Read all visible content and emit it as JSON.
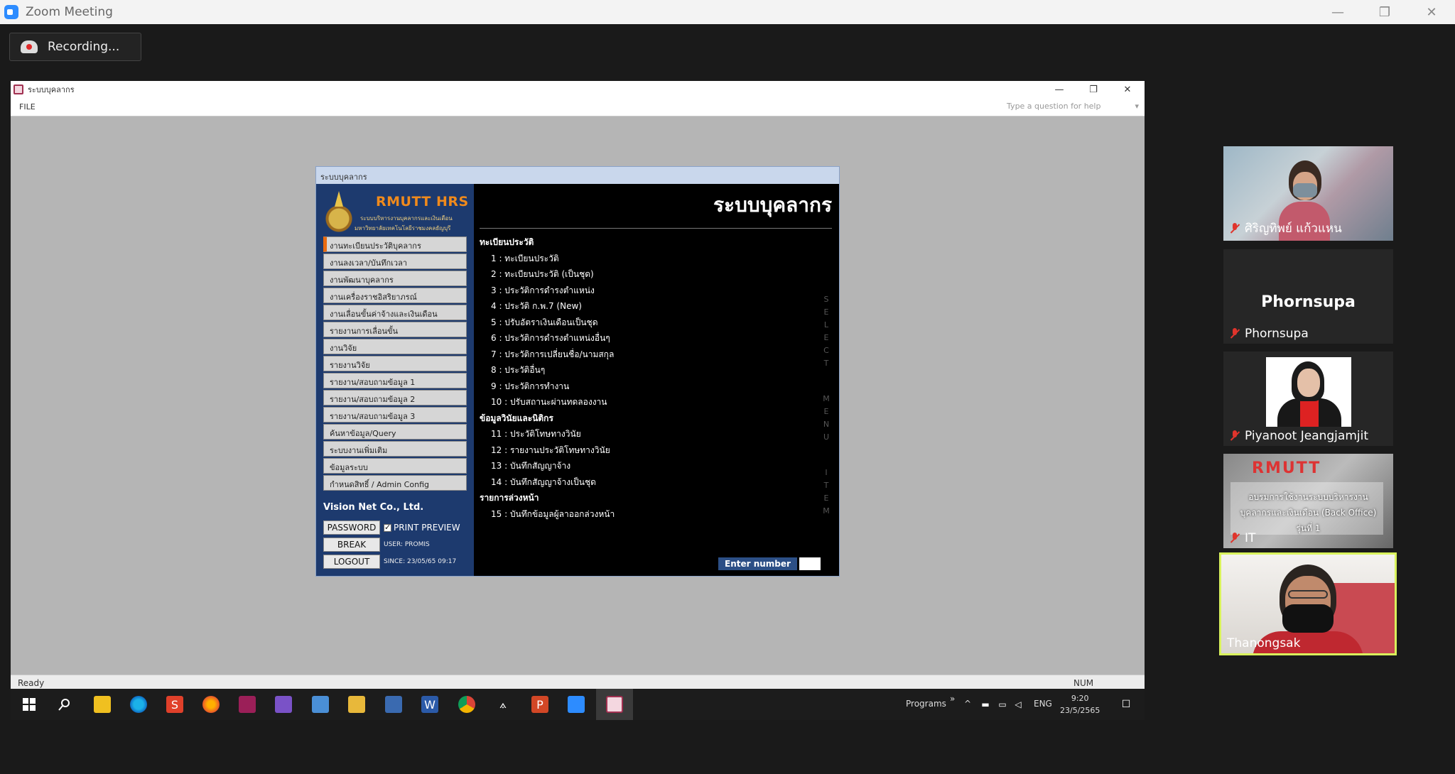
{
  "zoom": {
    "window_title": "Zoom Meeting",
    "recording_label": "Recording...",
    "controls": [
      "—",
      "❐",
      "✕"
    ]
  },
  "app": {
    "window_title": "ระบบบุคลากร",
    "controls": [
      "—",
      "❐",
      "✕"
    ],
    "menu_file": "FILE",
    "help_placeholder": "Type a question for help",
    "help_arrow": "▾",
    "status_ready": "Ready",
    "status_num": "NUM"
  },
  "dialog": {
    "title": "ระบบบุคลากร",
    "logo_name": "RMUTT HRS",
    "logo_sub1": "ระบบบริหารงานบุคลากรและเงินเดือน",
    "logo_sub2": "มหาวิทยาลัยเทคโนโลยีราชมงคลธัญบุรี",
    "nav": [
      "งานทะเบียนประวัติบุคลากร",
      "งานลงเวลา/บันทึกเวลา",
      "งานพัฒนาบุคลากร",
      "งานเครื่องราชอิสริยาภรณ์",
      "งานเลื่อนขั้นค่าจ้างและเงินเดือน",
      "รายงานการเลื่อนขั้น",
      "งานวิจัย",
      "รายงานวิจัย",
      "รายงาน/สอบถามข้อมูล 1",
      "รายงาน/สอบถามข้อมูล 2",
      "รายงาน/สอบถามข้อมูล 3",
      "ค้นหาข้อมูล/Query",
      "ระบบงานเพิ่มเติม",
      "ข้อมูลระบบ",
      "กำหนดสิทธิ์ / Admin Config"
    ],
    "vendor": "Vision Net Co., Ltd.",
    "password_btn": "PASSWORD",
    "print_preview": "PRINT PREVIEW",
    "break_btn": "BREAK",
    "user_info": "USER: PROMIS",
    "logout_btn": "LOGOUT",
    "since_info": "SINCE: 23/05/65 09:17",
    "system_title": "ระบบบุคลากร",
    "section1": "ทะเบียนประวัติ",
    "section2": "ข้อมูลวินัยและนิติกร",
    "section3": "รายการล่วงหน้า",
    "items": [
      "1 : ทะเบียนประวัติ",
      "2 : ทะเบียนประวัติ (เป็นชุด)",
      "3 : ประวัติการดำรงตำแหน่ง",
      "4 : ประวัติ ก.พ.7 (New)",
      "5 : ปรับอัตราเงินเดือนเป็นชุด",
      "6 : ประวัติการดำรงตำแหน่งอื่นๆ",
      "7 : ประวัติการเปลี่ยนชื่อ/นามสกุล",
      "8 : ประวัติอื่นๆ",
      "9 : ประวัติการทำงาน",
      "10 : ปรับสถานะผ่านทดลองงาน",
      "11 : ประวัติโทษทางวินัย",
      "12 : รายงานประวัติโทษทางวินัย",
      "13 : บันทึกสัญญาจ้าง",
      "14 : บันทึกสัญญาจ้างเป็นชุด",
      "15 : บันทึกข้อมูลผู้ลาออกล่วงหน้า"
    ],
    "vertical_letters": [
      "S",
      "E",
      "L",
      "E",
      "C",
      "T",
      "",
      "M",
      "E",
      "N",
      "U",
      "",
      "I",
      "T",
      "E",
      "M"
    ],
    "enter_number": "Enter number"
  },
  "taskbar": {
    "start_icon": "windows-start",
    "programs": "Programs",
    "tray_chevron": "»",
    "tray_up": "^",
    "lang": "ENG",
    "time": "9:20",
    "date": "23/5/2565"
  },
  "participants": [
    {
      "name": "ศิริญทิพย์ แก้วแหน"
    },
    {
      "name": "Phornsupa",
      "display": "Phornsupa"
    },
    {
      "name": "Piyanoot Jeangjamjit"
    },
    {
      "name": "IT",
      "lines": [
        "อบรมการใช้งานระบบบริหารงาน",
        "บุคลากรและเงินเดือน (Back Office)",
        "รุ่นที่ 1"
      ],
      "brand": "RMUTT"
    },
    {
      "name": "Thanongsak"
    }
  ]
}
